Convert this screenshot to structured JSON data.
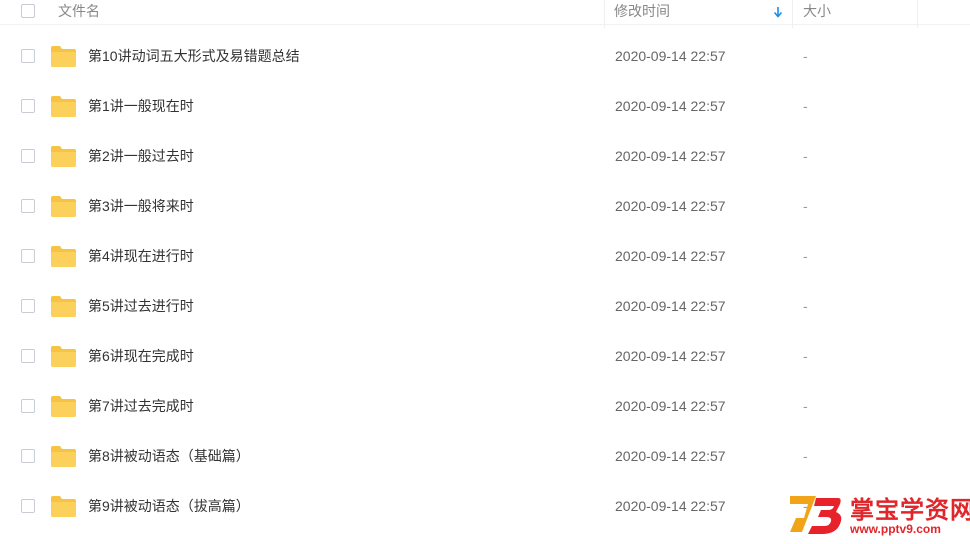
{
  "header": {
    "name_label": "文件名",
    "time_label": "修改时间",
    "size_label": "大小",
    "sort_icon": "sort-down-arrow-icon"
  },
  "files": [
    {
      "name": "第10讲动词五大形式及易错题总结",
      "modified": "2020-09-14 22:57",
      "size": "-"
    },
    {
      "name": "第1讲一般现在时",
      "modified": "2020-09-14 22:57",
      "size": "-"
    },
    {
      "name": "第2讲一般过去时",
      "modified": "2020-09-14 22:57",
      "size": "-"
    },
    {
      "name": "第3讲一般将来时",
      "modified": "2020-09-14 22:57",
      "size": "-"
    },
    {
      "name": "第4讲现在进行时",
      "modified": "2020-09-14 22:57",
      "size": "-"
    },
    {
      "name": "第5讲过去进行时",
      "modified": "2020-09-14 22:57",
      "size": "-"
    },
    {
      "name": "第6讲现在完成时",
      "modified": "2020-09-14 22:57",
      "size": "-"
    },
    {
      "name": "第7讲过去完成时",
      "modified": "2020-09-14 22:57",
      "size": "-"
    },
    {
      "name": "第8讲被动语态（基础篇）",
      "modified": "2020-09-14 22:57",
      "size": "-"
    },
    {
      "name": "第9讲被动语态（拔高篇）",
      "modified": "2020-09-14 22:57",
      "size": "-"
    }
  ],
  "watermark": {
    "title": "掌宝学资网",
    "url": "www.pptv9.com"
  },
  "colors": {
    "folder": "#f7c342",
    "accent": "#1e8ee6",
    "watermark": "#e0262b"
  }
}
